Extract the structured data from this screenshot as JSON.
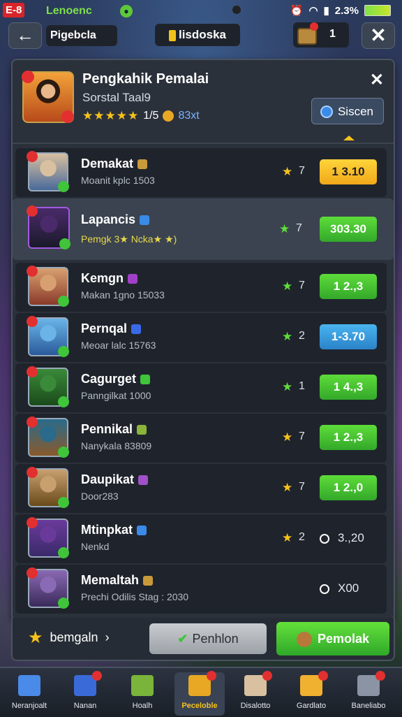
{
  "status_bar": {
    "app_badge": "E-8",
    "carrier": "Lenoenc",
    "battery_percent": "2.3%",
    "icons": [
      "alarm-icon",
      "wifi-icon",
      "signal-icon",
      "battery-icon"
    ]
  },
  "top_bar": {
    "title": "Pigebcla",
    "center_label": "lisdoska",
    "chest_count": "1",
    "back_icon": "arrow-left-icon",
    "close_icon": "close-icon"
  },
  "panel": {
    "title": "Pengkahik Pemalai",
    "subtitle": "Sorstal Taal9",
    "rating_stars": "★★★★★",
    "rating_text": "1/5",
    "rating_extra": "83xt",
    "search_label": "Siscen",
    "close_label": "✕"
  },
  "rows": [
    {
      "name": "Demakat",
      "sub": "Moanit kplc 1503",
      "star_color": "#f6c21c",
      "count": "7",
      "price": "1 3.10",
      "price_style": "yellow",
      "avatar_colors": [
        "#d8c0a0",
        "#4a6a9a"
      ],
      "tag_color": "#c99a3a"
    },
    {
      "name": "Lapancis",
      "sub": "Pemgk 3★ Ncka★ ★)",
      "star_color": "#5edc3a",
      "count": "7",
      "price": "303.30",
      "price_style": "green",
      "avatar_colors": [
        "#4a2a6a",
        "#1a1a2a"
      ],
      "tag_color": "#3a8ae8",
      "selected": true
    },
    {
      "name": "Kemgn",
      "sub": "Makan 1gno 15033",
      "star_color": "#5edc3a",
      "count": "7",
      "price": "1 2.,3",
      "price_style": "green",
      "avatar_colors": [
        "#d8a070",
        "#8a3a2a"
      ],
      "tag_color": "#a040c8"
    },
    {
      "name": "Pernqal",
      "sub": "Meoar lalc 15763",
      "star_color": "#5edc3a",
      "count": "2",
      "price": "1-3.70",
      "price_style": "blue",
      "avatar_colors": [
        "#6ab4e8",
        "#2a5a9a"
      ],
      "tag_color": "#3a6ae8"
    },
    {
      "name": "Cagurget",
      "sub": "Panngilkat 1000",
      "star_color": "#5edc3a",
      "count": "1",
      "price": "1 4.,3",
      "price_style": "green",
      "avatar_colors": [
        "#3a8a3a",
        "#1a4a1a"
      ],
      "tag_color": "#3fc43a"
    },
    {
      "name": "Pennikal",
      "sub": "Nanykala 83809",
      "star_color": "#f6c21c",
      "count": "7",
      "price": "1 2.,3",
      "price_style": "green",
      "avatar_colors": [
        "#2a6a8a",
        "#8a5a2a"
      ],
      "tag_color": "#8ab43a"
    },
    {
      "name": "Daupikat",
      "sub": "Door283",
      "star_color": "#f6c21c",
      "count": "7",
      "price": "1 2.,0",
      "price_style": "green",
      "avatar_colors": [
        "#c8a070",
        "#6a4a1a"
      ],
      "tag_color": "#a050c8"
    },
    {
      "name": "Mtinpkat",
      "sub": "Nenkd",
      "star_color": "#f6c21c",
      "count": "2",
      "price": "3.,20",
      "price_style": "none",
      "avatar_colors": [
        "#6a3a9a",
        "#3a2a6a"
      ],
      "tag_color": "#3a8ae8"
    },
    {
      "name": "Memaltah",
      "sub": "Prechi Odilis Stag : 2030",
      "star_color": "",
      "count": "",
      "price": "X00",
      "price_style": "none",
      "avatar_colors": [
        "#8a6ab4",
        "#3a2a5a"
      ],
      "tag_color": "#c99a3a"
    }
  ],
  "bottom_bar": {
    "left_label": "bemgaln",
    "left_chevron": "›",
    "gray_button": "Penhlon",
    "green_button": "Pemolak"
  },
  "nav": [
    {
      "label": "Neranjoalt",
      "icon": "cube-icon",
      "color": "#4a8ae8",
      "dot": false
    },
    {
      "label": "Nanan",
      "icon": "book-icon",
      "color": "#3a6ad8",
      "dot": true
    },
    {
      "label": "Hoalh",
      "icon": "house-icon",
      "color": "#7ab43a",
      "dot": false
    },
    {
      "label": "Peceloble",
      "icon": "puzzle-icon",
      "color": "#e8a824",
      "dot": true,
      "active": true
    },
    {
      "label": "Disalotto",
      "icon": "chest-icon",
      "color": "#d8c0a0",
      "dot": true
    },
    {
      "label": "Gardlato",
      "icon": "gift-icon",
      "color": "#f0b030",
      "dot": true
    },
    {
      "label": "Baneliabo",
      "icon": "refresh-icon",
      "color": "#8a94a4",
      "dot": true
    }
  ]
}
